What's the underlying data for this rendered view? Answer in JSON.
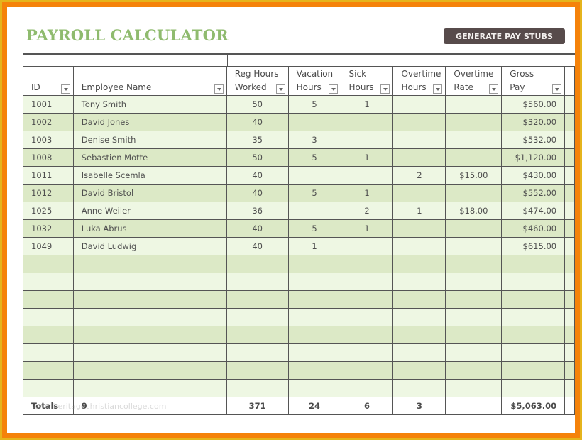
{
  "title": "PAYROLL CALCULATOR",
  "generate_button": "GENERATE  PAY STUBS",
  "columns": [
    {
      "line1": "",
      "line2": "ID"
    },
    {
      "line1": "",
      "line2": "Employee Name"
    },
    {
      "line1": "Reg Hours",
      "line2": "Worked"
    },
    {
      "line1": "Vacation",
      "line2": "Hours"
    },
    {
      "line1": "Sick",
      "line2": "Hours"
    },
    {
      "line1": "Overtime",
      "line2": "Hours"
    },
    {
      "line1": "Overtime",
      "line2": "Rate"
    },
    {
      "line1": "Gross",
      "line2": "Pay"
    }
  ],
  "rows": [
    {
      "id": "1001",
      "name": "Tony Smith",
      "reg": "50",
      "vac": "5",
      "sick": "1",
      "ot_hours": "",
      "ot_rate": "",
      "gross": "$560.00"
    },
    {
      "id": "1002",
      "name": "David Jones",
      "reg": "40",
      "vac": "",
      "sick": "",
      "ot_hours": "",
      "ot_rate": "",
      "gross": "$320.00"
    },
    {
      "id": "1003",
      "name": "Denise Smith",
      "reg": "35",
      "vac": "3",
      "sick": "",
      "ot_hours": "",
      "ot_rate": "",
      "gross": "$532.00"
    },
    {
      "id": "1008",
      "name": "Sebastien Motte",
      "reg": "50",
      "vac": "5",
      "sick": "1",
      "ot_hours": "",
      "ot_rate": "",
      "gross": "$1,120.00"
    },
    {
      "id": "1011",
      "name": "Isabelle Scemla",
      "reg": "40",
      "vac": "",
      "sick": "",
      "ot_hours": "2",
      "ot_rate": "$15.00",
      "gross": "$430.00"
    },
    {
      "id": "1012",
      "name": "David Bristol",
      "reg": "40",
      "vac": "5",
      "sick": "1",
      "ot_hours": "",
      "ot_rate": "",
      "gross": "$552.00"
    },
    {
      "id": "1025",
      "name": "Anne Weiler",
      "reg": "36",
      "vac": "",
      "sick": "2",
      "ot_hours": "1",
      "ot_rate": "$18.00",
      "gross": "$474.00"
    },
    {
      "id": "1032",
      "name": "Luka Abrus",
      "reg": "40",
      "vac": "5",
      "sick": "1",
      "ot_hours": "",
      "ot_rate": "",
      "gross": "$460.00"
    },
    {
      "id": "1049",
      "name": "David Ludwig",
      "reg": "40",
      "vac": "1",
      "sick": "",
      "ot_hours": "",
      "ot_rate": "",
      "gross": "$615.00"
    }
  ],
  "empty_rows": 8,
  "totals": {
    "label": "Totals",
    "count": "9",
    "reg": "371",
    "vac": "24",
    "sick": "6",
    "ot_hours": "3",
    "ot_rate": "",
    "gross": "$5,063.00"
  },
  "watermark": "www.heritagechristiancollege.com"
}
